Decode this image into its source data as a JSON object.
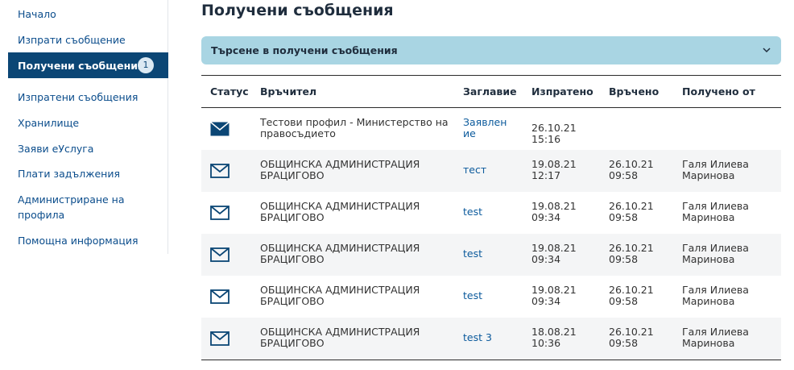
{
  "sidebar": {
    "items": [
      {
        "label": "Начало"
      },
      {
        "label": "Изпрати съобщение"
      },
      {
        "label": "Получени съобщения",
        "badge": "1",
        "active": true
      },
      {
        "label": "Изпратени съобщения"
      },
      {
        "label": "Хранилище"
      },
      {
        "label": "Заяви еУслуга"
      },
      {
        "label": "Плати задължения"
      },
      {
        "label": "Администриране на профила"
      },
      {
        "label": "Помощна информация"
      }
    ]
  },
  "main": {
    "title": "Получени съобщения",
    "search_label": "Търсене в получени съобщения",
    "table": {
      "headers": {
        "status": "Статус",
        "sender": "Връчител",
        "subject": "Заглавие",
        "sent": "Изпратено",
        "delivered": "Връчено",
        "received_by": "Получено от"
      },
      "rows": [
        {
          "status_icon": "envelope-closed-icon",
          "sender": "Тестови профил - Министерство на правосъдието",
          "subject": "Заявление",
          "sent": "26.10.21 15:16",
          "delivered": "",
          "received_by": ""
        },
        {
          "status_icon": "envelope-open-icon",
          "sender": "ОБЩИНСКА АДМИНИСТРАЦИЯ БРАЦИГОВО",
          "subject": "тест",
          "sent": "19.08.21 12:17",
          "delivered": "26.10.21 09:58",
          "received_by": "Галя Илиева Маринова"
        },
        {
          "status_icon": "envelope-open-icon",
          "sender": "ОБЩИНСКА АДМИНИСТРАЦИЯ БРАЦИГОВО",
          "subject": "test",
          "sent": "19.08.21 09:34",
          "delivered": "26.10.21 09:58",
          "received_by": "Галя Илиева Маринова"
        },
        {
          "status_icon": "envelope-open-icon",
          "sender": "ОБЩИНСКА АДМИНИСТРАЦИЯ БРАЦИГОВО",
          "subject": "test",
          "sent": "19.08.21 09:34",
          "delivered": "26.10.21 09:58",
          "received_by": "Галя Илиева Маринова"
        },
        {
          "status_icon": "envelope-open-icon",
          "sender": "ОБЩИНСКА АДМИНИСТРАЦИЯ БРАЦИГОВО",
          "subject": "test",
          "sent": "19.08.21 09:34",
          "delivered": "26.10.21 09:58",
          "received_by": "Галя Илиева Маринова"
        },
        {
          "status_icon": "envelope-open-icon",
          "sender": "ОБЩИНСКА АДМИНИСТРАЦИЯ БРАЦИГОВО",
          "subject": "test 3",
          "sent": "18.08.21 10:36",
          "delivered": "26.10.21 09:58",
          "received_by": "Галя Илиева Маринова"
        }
      ]
    }
  },
  "colors": {
    "nav_active_bg": "#0b4675",
    "link": "#0b5a9c",
    "search_bar_bg": "#a9d5e3",
    "icon": "#0b4675"
  }
}
